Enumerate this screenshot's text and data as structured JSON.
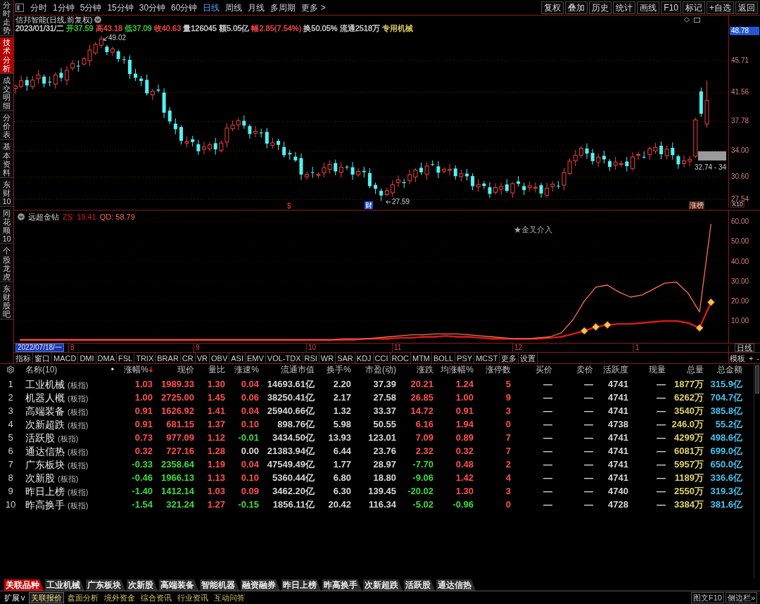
{
  "sidebar": {
    "tabs": [
      {
        "label": "分时走势",
        "selected": false
      },
      {
        "label": "技术分析",
        "selected": true
      },
      {
        "label": "成交明细",
        "selected": false
      },
      {
        "label": "分价表",
        "selected": false
      },
      {
        "label": "基本资料",
        "selected": false
      },
      {
        "label": "东财10",
        "selected": false
      },
      {
        "label": "同花顺10",
        "selected": false
      },
      {
        "label": "个股龙虎",
        "selected": false
      },
      {
        "label": "东财股吧",
        "selected": false
      }
    ]
  },
  "toolbar": {
    "periods": [
      {
        "label": "分时",
        "selected": false
      },
      {
        "label": "1分钟",
        "selected": false
      },
      {
        "label": "5分钟",
        "selected": false
      },
      {
        "label": "15分钟",
        "selected": false
      },
      {
        "label": "30分钟",
        "selected": false
      },
      {
        "label": "60分钟",
        "selected": false
      },
      {
        "label": "日线",
        "selected": true
      },
      {
        "label": "周线",
        "selected": false
      },
      {
        "label": "月线",
        "selected": false
      },
      {
        "label": "多周期",
        "selected": false
      },
      {
        "label": "更多 >",
        "selected": false
      }
    ],
    "buttons": [
      "复权",
      "叠加",
      "历史",
      "统计",
      "画线",
      "F10",
      "标记",
      "+自选",
      "返回"
    ]
  },
  "stock_header": {
    "title": "信邦智能(日线,前复权)",
    "quote": [
      {
        "text": "2023/01/31/二",
        "color": "#d8d8d8"
      },
      {
        "text": "开37.59",
        "color": "#3cd83c"
      },
      {
        "text": "高43.18",
        "color": "#ff4a4a"
      },
      {
        "text": "低37.09",
        "color": "#3cd83c"
      },
      {
        "text": "收40.63",
        "color": "#ff4a4a"
      },
      {
        "text": "量126045",
        "color": "#d8d8d8"
      },
      {
        "text": "额5.05亿",
        "color": "#d8d8d8"
      },
      {
        "text": "幅2.85(7.54%)",
        "color": "#ff4a4a"
      },
      {
        "text": "换50.05%",
        "color": "#d8d8d8"
      },
      {
        "text": "流通2518万",
        "color": "#d8d8d8"
      },
      {
        "text": "专用机械",
        "color": "#e8d468"
      }
    ]
  },
  "price_chart": {
    "axis_labels": [
      {
        "text": "48.78",
        "highlighted": true
      },
      {
        "text": "45.71",
        "highlighted": false
      },
      {
        "text": "41.56",
        "highlighted": false
      },
      {
        "text": "37.78",
        "highlighted": false
      },
      {
        "text": "34.00",
        "highlighted": false
      },
      {
        "text": "30.60",
        "highlighted": false
      },
      {
        "text": "27.54",
        "highlighted": false
      }
    ],
    "scale_label": "X10",
    "high_label": "49.02",
    "low_label": "27.59",
    "range_label": "32.74 - 34",
    "event_marks": [
      {
        "text": "$",
        "kind": "dividend"
      },
      {
        "text": "财",
        "kind": "report"
      },
      {
        "text": "涨榜",
        "kind": "ranking"
      }
    ]
  },
  "indicator": {
    "name": "远超金钻",
    "readings": [
      "ZS: 19.41",
      "QD: 58.79"
    ],
    "note": "★金叉介入",
    "chart_data": {
      "type": "line",
      "grid": true,
      "categories": [
        null,
        null,
        null,
        null,
        null,
        null,
        null,
        null,
        null,
        null,
        null,
        null,
        null,
        null,
        null,
        null,
        null,
        null,
        null,
        null,
        null,
        null,
        null,
        null,
        null,
        null,
        null,
        null,
        null,
        null,
        null,
        null,
        null,
        null,
        null,
        null,
        null,
        null,
        null,
        null,
        null,
        null,
        null,
        null,
        null,
        null,
        null,
        null,
        null,
        null,
        null,
        null,
        null,
        null,
        null,
        null,
        null,
        null,
        null,
        null,
        null,
        null
      ],
      "series": [
        {
          "color": "#e01818",
          "values": [
            0.5,
            0.5,
            0.5,
            0.5,
            0.5,
            0.5,
            0.5,
            0.5,
            0.5,
            0.5,
            0.5,
            0.5,
            0.5,
            0.5,
            0.5,
            0.5,
            0.5,
            0.5,
            0.5,
            0.5,
            0.5,
            0.5,
            0.5,
            0.5,
            0.5,
            0.5,
            0.5,
            0.5,
            0.5,
            0.5,
            1,
            1,
            1,
            1.5,
            1.5,
            2,
            2,
            2.5,
            2,
            2,
            1.5,
            1,
            1,
            1,
            1,
            1,
            1.5,
            2,
            3.5,
            5,
            7,
            8,
            8.5,
            8.5,
            9,
            9.5,
            10,
            10,
            9,
            6.5,
            19.41,
            null
          ]
        },
        {
          "color": "#ff7048",
          "values": [
            0.5,
            0.5,
            0.5,
            0.5,
            0.5,
            0.5,
            0.5,
            0.5,
            0.5,
            0.5,
            0.5,
            0.5,
            0.5,
            0.5,
            0.5,
            0.5,
            0.5,
            0.5,
            0.5,
            0.5,
            0.5,
            0.5,
            0.5,
            0.5,
            0.5,
            0.5,
            0.5,
            0.5,
            1,
            1,
            1,
            1.5,
            2,
            2.5,
            3,
            3,
            3.5,
            3.5,
            3.5,
            3,
            2.5,
            2,
            1.5,
            1,
            1,
            1.5,
            2,
            4,
            10.5,
            20,
            27,
            28,
            24.5,
            22,
            23,
            26,
            29,
            29.5,
            24,
            14.5,
            58.79,
            null
          ]
        }
      ],
      "ylim": [
        -1,
        65.5
      ],
      "yticks": [
        {
          "value": 10,
          "label": "10.00"
        },
        {
          "value": 20,
          "label": "20.00"
        },
        {
          "value": 30,
          "label": "30.00"
        },
        {
          "value": 40,
          "label": "40.00"
        },
        {
          "value": 50,
          "label": "50.00"
        },
        {
          "value": 60,
          "label": "60.00"
        }
      ]
    }
  },
  "date_axis": {
    "cursor_label": "2022/07/18/一",
    "month_labels": [
      "8",
      "9",
      "10",
      "11",
      "12",
      "1"
    ],
    "period_label": "日线"
  },
  "indicator_tabs": {
    "items": [
      "指标",
      "窗口",
      "MACD",
      "DMI",
      "DMA",
      "FSL",
      "TRIX",
      "BRAR",
      "CR",
      "VR",
      "OBV",
      "ASI",
      "EMV",
      "VOL-TDX",
      "RSI",
      "WR",
      "SAR",
      "KDJ",
      "CCI",
      "ROC",
      "MTM",
      "BOLL",
      "PSY",
      "MCST",
      "更多",
      "设置"
    ],
    "right": [
      "模板",
      "+",
      "-"
    ]
  },
  "table": {
    "name_header": "名称(10)",
    "name_marker": "•",
    "columns": [
      {
        "label": "涨幅%",
        "sorted": true
      },
      {
        "label": "现价",
        "sorted": false
      },
      {
        "label": "量比",
        "sorted": false
      },
      {
        "label": "涨速%",
        "sorted": false
      },
      {
        "label": "流通市值",
        "sorted": false
      },
      {
        "label": "换手%",
        "sorted": false
      },
      {
        "label": "市盈(动)",
        "sorted": false
      },
      {
        "label": "涨跌",
        "sorted": false
      },
      {
        "label": "均涨幅%",
        "sorted": false
      },
      {
        "label": "涨停数",
        "sorted": false
      },
      {
        "label": "买价",
        "sorted": false
      },
      {
        "label": "卖价",
        "sorted": false
      },
      {
        "label": "活跃度",
        "sorted": false
      },
      {
        "label": "现量",
        "sorted": false
      },
      {
        "label": "总量",
        "sorted": false
      },
      {
        "label": "总金额",
        "sorted": false
      }
    ],
    "rows": [
      {
        "number": "1",
        "name": "工业机械",
        "tag": "(板指)",
        "values": [
          {
            "text": "1.03",
            "color": "#ff5050"
          },
          {
            "text": "1989.33",
            "color": "#ff5050"
          },
          {
            "text": "1.30",
            "color": "#ff5050"
          },
          {
            "text": "0.04",
            "color": "#ff5050"
          },
          {
            "text": "14693.61亿",
            "color": "#d8d8d8"
          },
          {
            "text": "2.20",
            "color": "#d8d8d8"
          },
          {
            "text": "37.39",
            "color": "#d8d8d8"
          },
          {
            "text": "20.21",
            "color": "#ff5050"
          },
          {
            "text": "1.24",
            "color": "#ff5050"
          },
          {
            "text": "5",
            "color": "#ff5050"
          },
          {
            "text": "—",
            "color": "#d8d8d8"
          },
          {
            "text": "—",
            "color": "#d8d8d8"
          },
          {
            "text": "4741",
            "color": "#d8d8d8"
          },
          {
            "text": "—",
            "color": "#d8d8d8"
          },
          {
            "text": "1877万",
            "color": "#e2d46c"
          },
          {
            "text": "315.9亿",
            "color": "#48c4ee"
          }
        ]
      },
      {
        "number": "2",
        "name": "机器人概",
        "tag": "(板指)",
        "values": [
          {
            "text": "1.00",
            "color": "#ff5050"
          },
          {
            "text": "2725.00",
            "color": "#ff5050"
          },
          {
            "text": "1.45",
            "color": "#ff5050"
          },
          {
            "text": "0.06",
            "color": "#ff5050"
          },
          {
            "text": "38250.41亿",
            "color": "#d8d8d8"
          },
          {
            "text": "2.17",
            "color": "#d8d8d8"
          },
          {
            "text": "27.58",
            "color": "#d8d8d8"
          },
          {
            "text": "26.85",
            "color": "#ff5050"
          },
          {
            "text": "1.00",
            "color": "#ff5050"
          },
          {
            "text": "9",
            "color": "#ff5050"
          },
          {
            "text": "—",
            "color": "#d8d8d8"
          },
          {
            "text": "—",
            "color": "#d8d8d8"
          },
          {
            "text": "4741",
            "color": "#d8d8d8"
          },
          {
            "text": "—",
            "color": "#d8d8d8"
          },
          {
            "text": "6262万",
            "color": "#e2d46c"
          },
          {
            "text": "704.7亿",
            "color": "#48c4ee"
          }
        ]
      },
      {
        "number": "3",
        "name": "高端装备",
        "tag": "(板指)",
        "values": [
          {
            "text": "0.91",
            "color": "#ff5050"
          },
          {
            "text": "1626.92",
            "color": "#ff5050"
          },
          {
            "text": "1.41",
            "color": "#ff5050"
          },
          {
            "text": "0.04",
            "color": "#ff5050"
          },
          {
            "text": "25940.66亿",
            "color": "#d8d8d8"
          },
          {
            "text": "1.32",
            "color": "#d8d8d8"
          },
          {
            "text": "33.37",
            "color": "#d8d8d8"
          },
          {
            "text": "14.72",
            "color": "#ff5050"
          },
          {
            "text": "0.91",
            "color": "#ff5050"
          },
          {
            "text": "3",
            "color": "#ff5050"
          },
          {
            "text": "—",
            "color": "#d8d8d8"
          },
          {
            "text": "—",
            "color": "#d8d8d8"
          },
          {
            "text": "4741",
            "color": "#d8d8d8"
          },
          {
            "text": "—",
            "color": "#d8d8d8"
          },
          {
            "text": "3540万",
            "color": "#e2d46c"
          },
          {
            "text": "385.8亿",
            "color": "#48c4ee"
          }
        ]
      },
      {
        "number": "4",
        "name": "次新超跌",
        "tag": "(板指)",
        "values": [
          {
            "text": "0.91",
            "color": "#ff5050"
          },
          {
            "text": "681.15",
            "color": "#ff5050"
          },
          {
            "text": "1.37",
            "color": "#ff5050"
          },
          {
            "text": "0.10",
            "color": "#ff5050"
          },
          {
            "text": "898.76亿",
            "color": "#d8d8d8"
          },
          {
            "text": "5.98",
            "color": "#d8d8d8"
          },
          {
            "text": "50.55",
            "color": "#d8d8d8"
          },
          {
            "text": "6.16",
            "color": "#ff5050"
          },
          {
            "text": "1.94",
            "color": "#ff5050"
          },
          {
            "text": "0",
            "color": "#ff5050"
          },
          {
            "text": "—",
            "color": "#d8d8d8"
          },
          {
            "text": "—",
            "color": "#d8d8d8"
          },
          {
            "text": "4738",
            "color": "#d8d8d8"
          },
          {
            "text": "—",
            "color": "#d8d8d8"
          },
          {
            "text": "246.0万",
            "color": "#e2d46c"
          },
          {
            "text": "55.2亿",
            "color": "#48c4ee"
          }
        ]
      },
      {
        "number": "5",
        "name": "活跃股",
        "tag": "(板指)",
        "values": [
          {
            "text": "0.73",
            "color": "#ff5050"
          },
          {
            "text": "977.09",
            "color": "#ff5050"
          },
          {
            "text": "1.12",
            "color": "#ff5050"
          },
          {
            "text": "-0.01",
            "color": "#40dc40"
          },
          {
            "text": "3434.50亿",
            "color": "#d8d8d8"
          },
          {
            "text": "13.93",
            "color": "#d8d8d8"
          },
          {
            "text": "123.01",
            "color": "#d8d8d8"
          },
          {
            "text": "7.09",
            "color": "#ff5050"
          },
          {
            "text": "0.89",
            "color": "#ff5050"
          },
          {
            "text": "7",
            "color": "#ff5050"
          },
          {
            "text": "—",
            "color": "#d8d8d8"
          },
          {
            "text": "—",
            "color": "#d8d8d8"
          },
          {
            "text": "4741",
            "color": "#d8d8d8"
          },
          {
            "text": "—",
            "color": "#d8d8d8"
          },
          {
            "text": "4299万",
            "color": "#e2d46c"
          },
          {
            "text": "498.6亿",
            "color": "#48c4ee"
          }
        ]
      },
      {
        "number": "6",
        "name": "通达信热",
        "tag": "(板指)",
        "values": [
          {
            "text": "0.32",
            "color": "#ff5050"
          },
          {
            "text": "727.16",
            "color": "#ff5050"
          },
          {
            "text": "1.28",
            "color": "#ff5050"
          },
          {
            "text": "0.00",
            "color": "#d8d8d8"
          },
          {
            "text": "21383.94亿",
            "color": "#d8d8d8"
          },
          {
            "text": "6.44",
            "color": "#d8d8d8"
          },
          {
            "text": "23.76",
            "color": "#d8d8d8"
          },
          {
            "text": "2.32",
            "color": "#ff5050"
          },
          {
            "text": "0.32",
            "color": "#ff5050"
          },
          {
            "text": "7",
            "color": "#ff5050"
          },
          {
            "text": "—",
            "color": "#d8d8d8"
          },
          {
            "text": "—",
            "color": "#d8d8d8"
          },
          {
            "text": "4741",
            "color": "#d8d8d8"
          },
          {
            "text": "—",
            "color": "#d8d8d8"
          },
          {
            "text": "6081万",
            "color": "#e2d46c"
          },
          {
            "text": "699.0亿",
            "color": "#48c4ee"
          }
        ]
      },
      {
        "number": "7",
        "name": "广东板块",
        "tag": "(板指)",
        "values": [
          {
            "text": "-0.33",
            "color": "#40dc40"
          },
          {
            "text": "2358.64",
            "color": "#40dc40"
          },
          {
            "text": "1.19",
            "color": "#ff5050"
          },
          {
            "text": "0.04",
            "color": "#ff5050"
          },
          {
            "text": "47549.49亿",
            "color": "#d8d8d8"
          },
          {
            "text": "1.77",
            "color": "#d8d8d8"
          },
          {
            "text": "28.97",
            "color": "#d8d8d8"
          },
          {
            "text": "-7.70",
            "color": "#40dc40"
          },
          {
            "text": "0.48",
            "color": "#ff5050"
          },
          {
            "text": "2",
            "color": "#ff5050"
          },
          {
            "text": "—",
            "color": "#d8d8d8"
          },
          {
            "text": "—",
            "color": "#d8d8d8"
          },
          {
            "text": "4741",
            "color": "#d8d8d8"
          },
          {
            "text": "—",
            "color": "#d8d8d8"
          },
          {
            "text": "5957万",
            "color": "#e2d46c"
          },
          {
            "text": "650.0亿",
            "color": "#48c4ee"
          }
        ]
      },
      {
        "number": "8",
        "name": "次新股",
        "tag": "(板指)",
        "values": [
          {
            "text": "-0.46",
            "color": "#40dc40"
          },
          {
            "text": "1966.13",
            "color": "#40dc40"
          },
          {
            "text": "1.13",
            "color": "#ff5050"
          },
          {
            "text": "0.10",
            "color": "#ff5050"
          },
          {
            "text": "5360.44亿",
            "color": "#d8d8d8"
          },
          {
            "text": "6.80",
            "color": "#d8d8d8"
          },
          {
            "text": "18.80",
            "color": "#d8d8d8"
          },
          {
            "text": "-9.06",
            "color": "#40dc40"
          },
          {
            "text": "1.42",
            "color": "#ff5050"
          },
          {
            "text": "4",
            "color": "#ff5050"
          },
          {
            "text": "—",
            "color": "#d8d8d8"
          },
          {
            "text": "—",
            "color": "#d8d8d8"
          },
          {
            "text": "4741",
            "color": "#d8d8d8"
          },
          {
            "text": "—",
            "color": "#d8d8d8"
          },
          {
            "text": "1189万",
            "color": "#e2d46c"
          },
          {
            "text": "336.6亿",
            "color": "#48c4ee"
          }
        ]
      },
      {
        "number": "9",
        "name": "昨日上榜",
        "tag": "(板指)",
        "values": [
          {
            "text": "-1.40",
            "color": "#40dc40"
          },
          {
            "text": "1412.14",
            "color": "#40dc40"
          },
          {
            "text": "1.03",
            "color": "#ff5050"
          },
          {
            "text": "0.09",
            "color": "#ff5050"
          },
          {
            "text": "3462.20亿",
            "color": "#d8d8d8"
          },
          {
            "text": "6.30",
            "color": "#d8d8d8"
          },
          {
            "text": "139.45",
            "color": "#d8d8d8"
          },
          {
            "text": "-20.02",
            "color": "#40dc40"
          },
          {
            "text": "1.30",
            "color": "#ff5050"
          },
          {
            "text": "3",
            "color": "#ff5050"
          },
          {
            "text": "—",
            "color": "#d8d8d8"
          },
          {
            "text": "—",
            "color": "#d8d8d8"
          },
          {
            "text": "4740",
            "color": "#d8d8d8"
          },
          {
            "text": "—",
            "color": "#d8d8d8"
          },
          {
            "text": "2550万",
            "color": "#e2d46c"
          },
          {
            "text": "319.3亿",
            "color": "#48c4ee"
          }
        ]
      },
      {
        "number": "10",
        "name": "昨高换手",
        "tag": "(板指)",
        "values": [
          {
            "text": "-1.54",
            "color": "#40dc40"
          },
          {
            "text": "321.24",
            "color": "#40dc40"
          },
          {
            "text": "1.27",
            "color": "#ff5050"
          },
          {
            "text": "-0.15",
            "color": "#40dc40"
          },
          {
            "text": "1856.11亿",
            "color": "#d8d8d8"
          },
          {
            "text": "20.42",
            "color": "#d8d8d8"
          },
          {
            "text": "116.34",
            "color": "#d8d8d8"
          },
          {
            "text": "-5.02",
            "color": "#40dc40"
          },
          {
            "text": "-0.96",
            "color": "#40dc40"
          },
          {
            "text": "0",
            "color": "#ff5050"
          },
          {
            "text": "—",
            "color": "#d8d8d8"
          },
          {
            "text": "—",
            "color": "#d8d8d8"
          },
          {
            "text": "4728",
            "color": "#d8d8d8"
          },
          {
            "text": "—",
            "color": "#d8d8d8"
          },
          {
            "text": "3384万",
            "color": "#e2d46c"
          },
          {
            "text": "381.6亿",
            "color": "#48c4ee"
          }
        ]
      }
    ]
  },
  "bottom_tabs": [
    {
      "label": "关联品种",
      "selected": true
    },
    {
      "label": "工业机械",
      "selected": false
    },
    {
      "label": "广东板块",
      "selected": false
    },
    {
      "label": "次新股",
      "selected": false
    },
    {
      "label": "高端装备",
      "selected": false
    },
    {
      "label": "智能机器",
      "selected": false
    },
    {
      "label": "融资融券",
      "selected": false
    },
    {
      "label": "昨日上榜",
      "selected": false
    },
    {
      "label": "昨高换手",
      "selected": false
    },
    {
      "label": "次新超跌",
      "selected": false
    },
    {
      "label": "活跃股",
      "selected": false
    },
    {
      "label": "通达信热",
      "selected": false
    }
  ],
  "bottom_bar": {
    "expand": "扩展∨",
    "links": [
      {
        "label": "关联报价",
        "selected": true
      },
      {
        "label": "盘面分析",
        "selected": false
      },
      {
        "label": "境外资金",
        "selected": false
      },
      {
        "label": "综合资讯",
        "selected": false
      },
      {
        "label": "行业资讯",
        "selected": false
      },
      {
        "label": "互动问答",
        "selected": false
      }
    ],
    "right_buttons": [
      "图文F10",
      "侧边栏»"
    ]
  }
}
